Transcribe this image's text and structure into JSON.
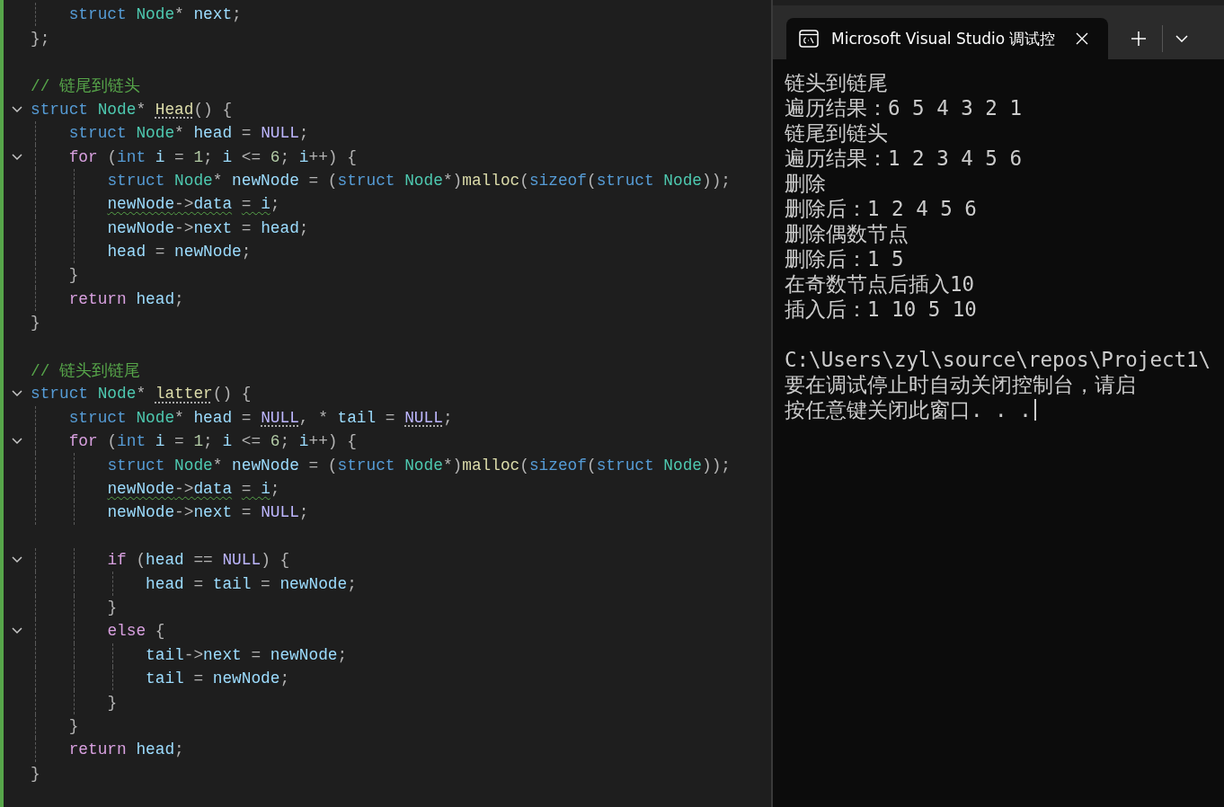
{
  "editor": {
    "lines": [
      {
        "kind": "code",
        "tokens": [
          {
            "text": "    struct ",
            "kind": "kw"
          },
          {
            "text": "Node",
            "kind": "type"
          },
          {
            "text": "* ",
            "kind": "punct"
          },
          {
            "text": "next",
            "kind": "var"
          },
          {
            "text": ";",
            "kind": "punct"
          }
        ]
      },
      {
        "kind": "code",
        "tokens": [
          {
            "text": "};",
            "kind": "punct"
          }
        ]
      },
      {
        "kind": "blank"
      },
      {
        "kind": "code",
        "tokens": [
          {
            "text": "// 链尾到链头",
            "kind": "comment"
          }
        ]
      },
      {
        "kind": "code",
        "expanded": true,
        "tokens": [
          {
            "text": "struct ",
            "kind": "kw"
          },
          {
            "text": "Node",
            "kind": "type"
          },
          {
            "text": "* ",
            "kind": "punct"
          },
          {
            "text": "Head",
            "kind": "func",
            "dotted": true
          },
          {
            "text": "() {",
            "kind": "punct"
          }
        ]
      },
      {
        "kind": "code",
        "tokens": [
          {
            "text": "    struct ",
            "kind": "kw"
          },
          {
            "text": "Node",
            "kind": "type"
          },
          {
            "text": "* ",
            "kind": "punct"
          },
          {
            "text": "head",
            "kind": "var"
          },
          {
            "text": " = ",
            "kind": "punct"
          },
          {
            "text": "NULL",
            "kind": "macro"
          },
          {
            "text": ";",
            "kind": "punct"
          }
        ]
      },
      {
        "kind": "code",
        "expanded": true,
        "tokens": [
          {
            "text": "    for ",
            "kind": "ctrl"
          },
          {
            "text": "(",
            "kind": "punct"
          },
          {
            "text": "int ",
            "kind": "kw"
          },
          {
            "text": "i",
            "kind": "var"
          },
          {
            "text": " = ",
            "kind": "punct"
          },
          {
            "text": "1",
            "kind": "num"
          },
          {
            "text": "; ",
            "kind": "punct"
          },
          {
            "text": "i",
            "kind": "var"
          },
          {
            "text": " <= ",
            "kind": "punct"
          },
          {
            "text": "6",
            "kind": "num"
          },
          {
            "text": "; ",
            "kind": "punct"
          },
          {
            "text": "i",
            "kind": "var"
          },
          {
            "text": "++) {",
            "kind": "punct"
          }
        ]
      },
      {
        "kind": "code",
        "tokens": [
          {
            "text": "        struct ",
            "kind": "kw"
          },
          {
            "text": "Node",
            "kind": "type"
          },
          {
            "text": "* ",
            "kind": "punct"
          },
          {
            "text": "newNode",
            "kind": "var"
          },
          {
            "text": " = (",
            "kind": "punct"
          },
          {
            "text": "struct ",
            "kind": "kw"
          },
          {
            "text": "Node",
            "kind": "type"
          },
          {
            "text": "*)",
            "kind": "punct"
          },
          {
            "text": "malloc",
            "kind": "func"
          },
          {
            "text": "(",
            "kind": "punct"
          },
          {
            "text": "sizeof",
            "kind": "kw"
          },
          {
            "text": "(",
            "kind": "punct"
          },
          {
            "text": "struct ",
            "kind": "kw"
          },
          {
            "text": "Node",
            "kind": "type"
          },
          {
            "text": "));",
            "kind": "punct"
          }
        ]
      },
      {
        "kind": "code",
        "tokens": [
          {
            "text": "        newNode",
            "kind": "var",
            "squiggly": true
          },
          {
            "text": "->",
            "kind": "punct",
            "squiggly": true
          },
          {
            "text": "data",
            "kind": "var",
            "squiggly": true
          },
          {
            "text": " = ",
            "kind": "punct",
            "squiggly": true
          },
          {
            "text": "i",
            "kind": "var",
            "squiggly": true
          },
          {
            "text": ";",
            "kind": "punct"
          }
        ]
      },
      {
        "kind": "code",
        "tokens": [
          {
            "text": "        newNode",
            "kind": "var"
          },
          {
            "text": "->",
            "kind": "punct"
          },
          {
            "text": "next",
            "kind": "var"
          },
          {
            "text": " = ",
            "kind": "punct"
          },
          {
            "text": "head",
            "kind": "var"
          },
          {
            "text": ";",
            "kind": "punct"
          }
        ]
      },
      {
        "kind": "code",
        "tokens": [
          {
            "text": "        head",
            "kind": "var"
          },
          {
            "text": " = ",
            "kind": "punct"
          },
          {
            "text": "newNode",
            "kind": "var"
          },
          {
            "text": ";",
            "kind": "punct"
          }
        ]
      },
      {
        "kind": "code",
        "tokens": [
          {
            "text": "    }",
            "kind": "punct"
          }
        ]
      },
      {
        "kind": "code",
        "tokens": [
          {
            "text": "    return ",
            "kind": "ctrl"
          },
          {
            "text": "head",
            "kind": "var"
          },
          {
            "text": ";",
            "kind": "punct"
          }
        ]
      },
      {
        "kind": "code",
        "tokens": [
          {
            "text": "}",
            "kind": "punct"
          }
        ]
      },
      {
        "kind": "blank"
      },
      {
        "kind": "code",
        "tokens": [
          {
            "text": "// 链头到链尾",
            "kind": "comment"
          }
        ]
      },
      {
        "kind": "code",
        "expanded": true,
        "tokens": [
          {
            "text": "struct ",
            "kind": "kw"
          },
          {
            "text": "Node",
            "kind": "type"
          },
          {
            "text": "* ",
            "kind": "punct"
          },
          {
            "text": "latter",
            "kind": "func",
            "dotted": true
          },
          {
            "text": "() {",
            "kind": "punct"
          }
        ]
      },
      {
        "kind": "code",
        "tokens": [
          {
            "text": "    struct ",
            "kind": "kw"
          },
          {
            "text": "Node",
            "kind": "type"
          },
          {
            "text": "* ",
            "kind": "punct"
          },
          {
            "text": "head",
            "kind": "var"
          },
          {
            "text": " = ",
            "kind": "punct"
          },
          {
            "text": "NULL",
            "kind": "macro",
            "dotted": true
          },
          {
            "text": ", * ",
            "kind": "punct"
          },
          {
            "text": "tail",
            "kind": "var"
          },
          {
            "text": " = ",
            "kind": "punct"
          },
          {
            "text": "NULL",
            "kind": "macro",
            "dotted": true
          },
          {
            "text": ";",
            "kind": "punct"
          }
        ]
      },
      {
        "kind": "code",
        "expanded": true,
        "tokens": [
          {
            "text": "    for ",
            "kind": "ctrl"
          },
          {
            "text": "(",
            "kind": "punct"
          },
          {
            "text": "int ",
            "kind": "kw"
          },
          {
            "text": "i",
            "kind": "var"
          },
          {
            "text": " = ",
            "kind": "punct"
          },
          {
            "text": "1",
            "kind": "num"
          },
          {
            "text": "; ",
            "kind": "punct"
          },
          {
            "text": "i",
            "kind": "var"
          },
          {
            "text": " <= ",
            "kind": "punct"
          },
          {
            "text": "6",
            "kind": "num"
          },
          {
            "text": "; ",
            "kind": "punct"
          },
          {
            "text": "i",
            "kind": "var"
          },
          {
            "text": "++) {",
            "kind": "punct"
          }
        ]
      },
      {
        "kind": "code",
        "tokens": [
          {
            "text": "        struct ",
            "kind": "kw"
          },
          {
            "text": "Node",
            "kind": "type"
          },
          {
            "text": "* ",
            "kind": "punct"
          },
          {
            "text": "newNode",
            "kind": "var"
          },
          {
            "text": " = (",
            "kind": "punct"
          },
          {
            "text": "struct ",
            "kind": "kw"
          },
          {
            "text": "Node",
            "kind": "type"
          },
          {
            "text": "*)",
            "kind": "punct"
          },
          {
            "text": "malloc",
            "kind": "func"
          },
          {
            "text": "(",
            "kind": "punct"
          },
          {
            "text": "sizeof",
            "kind": "kw"
          },
          {
            "text": "(",
            "kind": "punct"
          },
          {
            "text": "struct ",
            "kind": "kw"
          },
          {
            "text": "Node",
            "kind": "type"
          },
          {
            "text": "));",
            "kind": "punct"
          }
        ]
      },
      {
        "kind": "code",
        "tokens": [
          {
            "text": "        newNode",
            "kind": "var",
            "squiggly": true
          },
          {
            "text": "->",
            "kind": "punct",
            "squiggly": true
          },
          {
            "text": "data",
            "kind": "var",
            "squiggly": true
          },
          {
            "text": " = ",
            "kind": "punct",
            "squiggly": true
          },
          {
            "text": "i",
            "kind": "var",
            "squiggly": true
          },
          {
            "text": ";",
            "kind": "punct"
          }
        ]
      },
      {
        "kind": "code",
        "tokens": [
          {
            "text": "        newNode",
            "kind": "var"
          },
          {
            "text": "->",
            "kind": "punct"
          },
          {
            "text": "next",
            "kind": "var"
          },
          {
            "text": " = ",
            "kind": "punct"
          },
          {
            "text": "NULL",
            "kind": "macro"
          },
          {
            "text": ";",
            "kind": "punct"
          }
        ]
      },
      {
        "kind": "blank"
      },
      {
        "kind": "code",
        "expanded": true,
        "tokens": [
          {
            "text": "        if ",
            "kind": "ctrl"
          },
          {
            "text": "(",
            "kind": "punct"
          },
          {
            "text": "head",
            "kind": "var"
          },
          {
            "text": " == ",
            "kind": "punct"
          },
          {
            "text": "NULL",
            "kind": "macro"
          },
          {
            "text": ") {",
            "kind": "punct"
          }
        ]
      },
      {
        "kind": "code",
        "tokens": [
          {
            "text": "            head",
            "kind": "var"
          },
          {
            "text": " = ",
            "kind": "punct"
          },
          {
            "text": "tail",
            "kind": "var"
          },
          {
            "text": " = ",
            "kind": "punct"
          },
          {
            "text": "newNode",
            "kind": "var"
          },
          {
            "text": ";",
            "kind": "punct"
          }
        ]
      },
      {
        "kind": "code",
        "tokens": [
          {
            "text": "        }",
            "kind": "punct"
          }
        ]
      },
      {
        "kind": "code",
        "expanded": true,
        "tokens": [
          {
            "text": "        else ",
            "kind": "ctrl"
          },
          {
            "text": "{",
            "kind": "punct"
          }
        ]
      },
      {
        "kind": "code",
        "tokens": [
          {
            "text": "            tail",
            "kind": "var"
          },
          {
            "text": "->",
            "kind": "punct"
          },
          {
            "text": "next",
            "kind": "var"
          },
          {
            "text": " = ",
            "kind": "punct"
          },
          {
            "text": "newNode",
            "kind": "var"
          },
          {
            "text": ";",
            "kind": "punct"
          }
        ]
      },
      {
        "kind": "code",
        "tokens": [
          {
            "text": "            tail",
            "kind": "var"
          },
          {
            "text": " = ",
            "kind": "punct"
          },
          {
            "text": "newNode",
            "kind": "var"
          },
          {
            "text": ";",
            "kind": "punct"
          }
        ]
      },
      {
        "kind": "code",
        "tokens": [
          {
            "text": "        }",
            "kind": "punct"
          }
        ]
      },
      {
        "kind": "code",
        "tokens": [
          {
            "text": "    }",
            "kind": "punct"
          }
        ]
      },
      {
        "kind": "code",
        "tokens": [
          {
            "text": "    return ",
            "kind": "ctrl"
          },
          {
            "text": "head",
            "kind": "var"
          },
          {
            "text": ";",
            "kind": "punct"
          }
        ]
      },
      {
        "kind": "code",
        "tokens": [
          {
            "text": "}",
            "kind": "punct"
          }
        ]
      }
    ]
  },
  "terminal": {
    "tab": {
      "title": "Microsoft Visual Studio 调试控",
      "selected": true
    },
    "lines": [
      {
        "kind": "text",
        "text": "链头到链尾"
      },
      {
        "kind": "text",
        "text": "遍历结果：6 5 4 3 2 1"
      },
      {
        "kind": "text",
        "text": "链尾到链头"
      },
      {
        "kind": "text",
        "text": "遍历结果：1 2 3 4 5 6"
      },
      {
        "kind": "text",
        "text": "删除"
      },
      {
        "kind": "text",
        "text": "删除后：1 2 4 5 6"
      },
      {
        "kind": "text",
        "text": "删除偶数节点"
      },
      {
        "kind": "text",
        "text": "删除后：1 5"
      },
      {
        "kind": "text",
        "text": "在奇数节点后插入10"
      },
      {
        "kind": "text",
        "text": "插入后：1 10 5 10"
      },
      {
        "kind": "blank"
      },
      {
        "kind": "text",
        "text": "C:\\Users\\zyl\\source\\repos\\Project1\\"
      },
      {
        "kind": "text",
        "text": "要在调试停止时自动关闭控制台，请启"
      },
      {
        "kind": "prompt",
        "text": "按任意键关闭此窗口. . ."
      }
    ]
  }
}
